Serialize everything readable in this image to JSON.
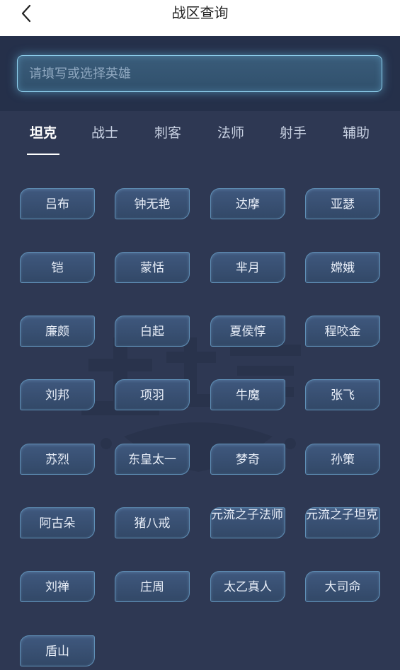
{
  "header": {
    "title": "战区查询",
    "back_icon": "chevron-left-icon"
  },
  "search": {
    "placeholder": "请填写或选择英雄",
    "value": ""
  },
  "tabs": [
    {
      "label": "坦克",
      "active": true
    },
    {
      "label": "战士",
      "active": false
    },
    {
      "label": "刺客",
      "active": false
    },
    {
      "label": "法师",
      "active": false
    },
    {
      "label": "射手",
      "active": false
    },
    {
      "label": "辅助",
      "active": false
    }
  ],
  "heroes": [
    "吕布",
    "钟无艳",
    "达摩",
    "亚瑟",
    "铠",
    "蒙恬",
    "芈月",
    "嫦娥",
    "廉颇",
    "白起",
    "夏侯惇",
    "程咬金",
    "刘邦",
    "项羽",
    "牛魔",
    "张飞",
    "苏烈",
    "东皇太一",
    "梦奇",
    "孙策",
    "阿古朵",
    "猪八戒",
    "元流之子法师",
    "元流之子坦克",
    "刘禅",
    "庄周",
    "太乙真人",
    "大司命",
    "盾山"
  ],
  "colors": {
    "accent": "#8fd0ee",
    "background": "#2e3853",
    "search_bg": "#25304a"
  }
}
